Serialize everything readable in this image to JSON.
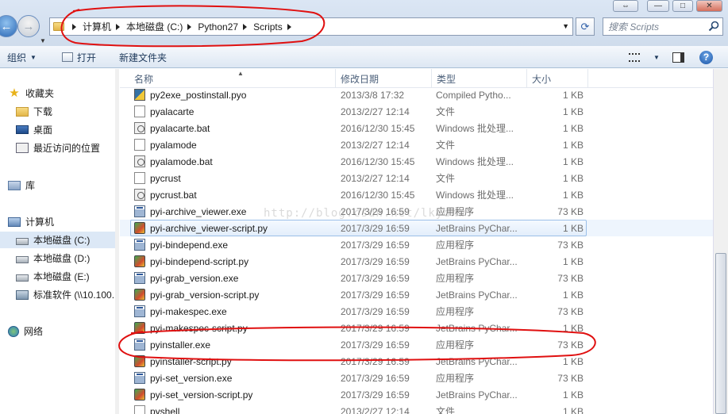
{
  "window": {
    "controls": {
      "minimize": "—",
      "maximize": "□",
      "close": "✕",
      "extra": "⇔"
    }
  },
  "address": {
    "crumbs": [
      "计算机",
      "本地磁盘 (C:)",
      "Python27",
      "Scripts"
    ]
  },
  "search": {
    "placeholder": "搜索 Scripts"
  },
  "toolbar": {
    "organize": "组织",
    "open": "打开",
    "new_folder": "新建文件夹"
  },
  "nav": {
    "items": [
      {
        "label": "收藏夹",
        "icon": "star-icon"
      },
      {
        "label": "下载",
        "icon": "download-folder-icon"
      },
      {
        "label": "桌面",
        "icon": "desktop-icon"
      },
      {
        "label": "最近访问的位置",
        "icon": "recent-places-icon"
      },
      {
        "label": "库",
        "icon": "library-icon"
      },
      {
        "label": "计算机",
        "icon": "computer-icon"
      },
      {
        "label": "本地磁盘 (C:)",
        "icon": "drive-icon"
      },
      {
        "label": "本地磁盘 (D:)",
        "icon": "drive-icon"
      },
      {
        "label": "本地磁盘 (E:)",
        "icon": "drive-icon"
      },
      {
        "label": "标准软件 (\\\\10.100.",
        "icon": "network-drive-icon"
      },
      {
        "label": "网络",
        "icon": "network-icon"
      }
    ]
  },
  "columns": {
    "name": "名称",
    "date": "修改日期",
    "type": "类型",
    "size": "大小"
  },
  "files": [
    {
      "name": "py2exe_postinstall.pyo",
      "date": "2013/3/8 17:32",
      "type": "Compiled Pytho...",
      "size": "1 KB",
      "icon": "pyo"
    },
    {
      "name": "pyalacarte",
      "date": "2013/2/27 12:14",
      "type": "文件",
      "size": "1 KB",
      "icon": "file"
    },
    {
      "name": "pyalacarte.bat",
      "date": "2016/12/30 15:45",
      "type": "Windows 批处理...",
      "size": "1 KB",
      "icon": "bat"
    },
    {
      "name": "pyalamode",
      "date": "2013/2/27 12:14",
      "type": "文件",
      "size": "1 KB",
      "icon": "file"
    },
    {
      "name": "pyalamode.bat",
      "date": "2016/12/30 15:45",
      "type": "Windows 批处理...",
      "size": "1 KB",
      "icon": "bat"
    },
    {
      "name": "pycrust",
      "date": "2013/2/27 12:14",
      "type": "文件",
      "size": "1 KB",
      "icon": "file"
    },
    {
      "name": "pycrust.bat",
      "date": "2016/12/30 15:45",
      "type": "Windows 批处理...",
      "size": "1 KB",
      "icon": "bat"
    },
    {
      "name": "pyi-archive_viewer.exe",
      "date": "2017/3/29 16:59",
      "type": "应用程序",
      "size": "73 KB",
      "icon": "exe"
    },
    {
      "name": "pyi-archive_viewer-script.py",
      "date": "2017/3/29 16:59",
      "type": "JetBrains PyChar...",
      "size": "1 KB",
      "icon": "py"
    },
    {
      "name": "pyi-bindepend.exe",
      "date": "2017/3/29 16:59",
      "type": "应用程序",
      "size": "73 KB",
      "icon": "exe"
    },
    {
      "name": "pyi-bindepend-script.py",
      "date": "2017/3/29 16:59",
      "type": "JetBrains PyChar...",
      "size": "1 KB",
      "icon": "py"
    },
    {
      "name": "pyi-grab_version.exe",
      "date": "2017/3/29 16:59",
      "type": "应用程序",
      "size": "73 KB",
      "icon": "exe"
    },
    {
      "name": "pyi-grab_version-script.py",
      "date": "2017/3/29 16:59",
      "type": "JetBrains PyChar...",
      "size": "1 KB",
      "icon": "py"
    },
    {
      "name": "pyi-makespec.exe",
      "date": "2017/3/29 16:59",
      "type": "应用程序",
      "size": "73 KB",
      "icon": "exe"
    },
    {
      "name": "pyi-makespec-script.py",
      "date": "2017/3/29 16:59",
      "type": "JetBrains PyChar...",
      "size": "1 KB",
      "icon": "py"
    },
    {
      "name": "pyinstaller.exe",
      "date": "2017/3/29 16:59",
      "type": "应用程序",
      "size": "73 KB",
      "icon": "exe"
    },
    {
      "name": "pyinstaller-script.py",
      "date": "2017/3/29 16:59",
      "type": "JetBrains PyChar...",
      "size": "1 KB",
      "icon": "py"
    },
    {
      "name": "pyi-set_version.exe",
      "date": "2017/3/29 16:59",
      "type": "应用程序",
      "size": "73 KB",
      "icon": "exe"
    },
    {
      "name": "pyi-set_version-script.py",
      "date": "2017/3/29 16:59",
      "type": "JetBrains PyChar...",
      "size": "1 KB",
      "icon": "py"
    },
    {
      "name": "pyshell",
      "date": "2013/2/27 12:14",
      "type": "文件",
      "size": "1 KB",
      "icon": "file"
    }
  ],
  "hover_index": 8,
  "watermark": "http://blog.csdn.net/lkydhw",
  "annotation_color": "#e01010"
}
